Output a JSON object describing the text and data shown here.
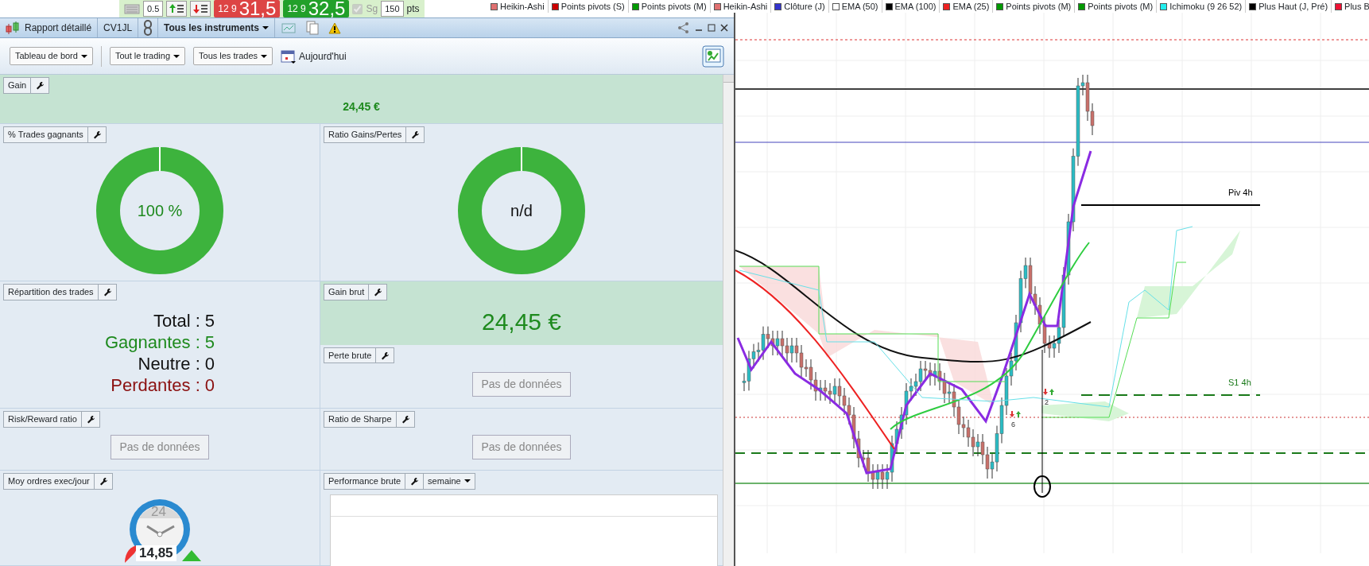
{
  "order_toolbar": {
    "quantity": "0.5",
    "sell": {
      "lots": "12 9",
      "price": "31,5"
    },
    "buy": {
      "lots": "12 9",
      "price": "32,5"
    },
    "sg": {
      "label": "Sg",
      "checked": true,
      "disabled": true
    },
    "points": {
      "value": "150",
      "unit": "pts"
    }
  },
  "indicator_legend": [
    {
      "label": "Heikin-Ashi",
      "color": "#e07070"
    },
    {
      "label": "Points pivots (S)",
      "color": "#cc0000"
    },
    {
      "label": "Points pivots (M)",
      "color": "#009900"
    },
    {
      "label": "Heikin-Ashi",
      "color": "#e07070"
    },
    {
      "label": "Clôture (J)",
      "color": "#3333cc"
    },
    {
      "label": "EMA (50)",
      "color": "#ffffff"
    },
    {
      "label": "EMA (100)",
      "color": "#000000"
    },
    {
      "label": "EMA (25)",
      "color": "#ee2222"
    },
    {
      "label": "Points pivots (M)",
      "color": "#009900"
    },
    {
      "label": "Points pivots (M)",
      "color": "#009900"
    },
    {
      "label": "Ichimoku (9 26 52)",
      "color": "#22eeee"
    },
    {
      "label": "Plus Haut (J, Pré)",
      "color": "#000000"
    },
    {
      "label": "Plus B",
      "color": "#ee1133"
    }
  ],
  "report_window": {
    "title": "Rapport détaillé",
    "account": "CV1JL",
    "instrument_filter": "Tous les instruments",
    "toolbar": {
      "dropdowns": [
        "Tableau de bord",
        "Tout le trading",
        "Tous les trades"
      ],
      "date_button": "Aujourd'hui"
    },
    "rows": [
      {
        "cells": [
          {
            "widgets": [
              {
                "title": "Gain",
                "kind": "value",
                "value": "24,45 €",
                "highlight": true
              }
            ]
          }
        ]
      },
      {
        "cells": [
          {
            "widgets": [
              {
                "title": "% Trades gagnants",
                "kind": "donut",
                "label": "100 %",
                "highlight": false
              }
            ]
          },
          {
            "widgets": [
              {
                "title": "Ratio Gains/Pertes",
                "kind": "donut",
                "label": "n/d",
                "highlight": false
              }
            ]
          }
        ]
      },
      {
        "cells": [
          {
            "widgets": [
              {
                "title": "Répartition des trades",
                "kind": "breakdown",
                "highlight": false,
                "lines": [
                  {
                    "text": "Total : 5",
                    "color": "#111111"
                  },
                  {
                    "text": "Gagnantes : 5",
                    "color": "#1e8a1e"
                  },
                  {
                    "text": "Neutre : 0",
                    "color": "#111111"
                  },
                  {
                    "text": "Perdantes : 0",
                    "color": "#8b1010"
                  }
                ]
              }
            ]
          },
          {
            "widgets": [
              {
                "title": "Gain brut",
                "kind": "value",
                "value": "24,45 €",
                "highlight": true
              },
              {
                "title": "Perte brute",
                "kind": "empty",
                "message": "Pas de données",
                "highlight": false
              }
            ]
          }
        ]
      },
      {
        "cells": [
          {
            "widgets": [
              {
                "title": "Risk/Reward ratio",
                "kind": "empty",
                "message": "Pas de données",
                "highlight": false
              }
            ]
          },
          {
            "widgets": [
              {
                "title": "Ratio de Sharpe",
                "kind": "empty",
                "message": "Pas de données",
                "highlight": false
              }
            ]
          }
        ]
      },
      {
        "cells": [
          {
            "widgets": [
              {
                "title": "Moy ordres exec/jour",
                "kind": "gauge",
                "dial": "24",
                "value": "14,85",
                "highlight": false
              }
            ]
          },
          {
            "widgets": [
              {
                "title": "Performance brute",
                "kind": "chart_area",
                "period": "semaine",
                "highlight": false
              }
            ]
          }
        ]
      }
    ]
  },
  "price_chart": {
    "levels": [
      {
        "label": "Piv 4h",
        "kind": "pivot"
      },
      {
        "label": "S1 4h",
        "kind": "support"
      }
    ],
    "signals": [
      "6",
      "2"
    ]
  }
}
